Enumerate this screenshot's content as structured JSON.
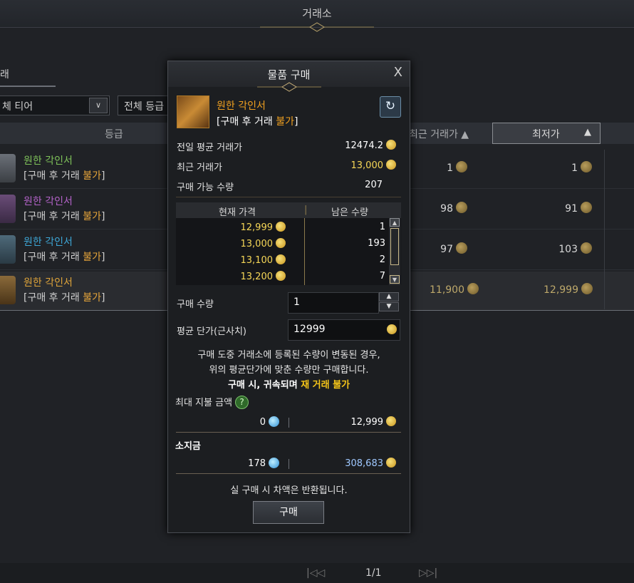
{
  "window": {
    "title": "거래소"
  },
  "background": {
    "tab_label": "래",
    "tier_dropdown": "체 티어",
    "grade_dropdown": "전체 등급",
    "header": {
      "grade": "등급",
      "recent": "최근 거래가",
      "lowest": "최저가"
    },
    "rows": [
      {
        "name": "원한 각인서",
        "note_prefix": "[구매 후 거래 ",
        "note_flag": "불가",
        "note_suffix": "]",
        "recent": "1",
        "lowest": "1",
        "name_color": "#7fc35a"
      },
      {
        "name": "원한 각인서",
        "note_prefix": "[구매 후 거래 ",
        "note_flag": "불가",
        "note_suffix": "]",
        "recent": "98",
        "lowest": "91",
        "name_color": "#b463c9"
      },
      {
        "name": "원한 각인서",
        "note_prefix": "[구매 후 거래 ",
        "note_flag": "불가",
        "note_suffix": "]",
        "recent": "97",
        "lowest": "103",
        "name_color": "#3ea8d8"
      },
      {
        "name": "원한 각인서",
        "note_prefix": "[구매 후 거래 ",
        "note_flag": "불가",
        "note_suffix": "]",
        "recent": "11,900",
        "lowest": "12,999",
        "name_color": "#e0a53a"
      }
    ],
    "pager": {
      "page": "1/1"
    }
  },
  "modal": {
    "title": "물품 구매",
    "close": "X",
    "item_name": "원한 각인서",
    "item_note_prefix": "[구매 후 거래 ",
    "item_note_flag": "불가",
    "item_note_suffix": "]",
    "stats": [
      {
        "label": "전일 평균 거래가",
        "value": "12474.2"
      },
      {
        "label": "최근 거래가",
        "value": "13,000"
      },
      {
        "label": "구매 가능 수량",
        "value": "207"
      }
    ],
    "table": {
      "col_price": "현재 가격",
      "col_qty": "남은 수량",
      "rows": [
        {
          "price": "12,999",
          "qty": "1"
        },
        {
          "price": "13,000",
          "qty": "193"
        },
        {
          "price": "13,100",
          "qty": "2"
        },
        {
          "price": "13,200",
          "qty": "7"
        }
      ]
    },
    "qty_label": "구매 수량",
    "qty_value": "1",
    "avg_label": "평균 단가(근사치)",
    "avg_value": "12999",
    "notice_line1": "구매 도중 거래소에 등록된 수량이 변동된 경우,",
    "notice_line2": "위의 평균단가에 맞춘 수량만 구매합니다.",
    "notice_line3_a": "구매 시, 귀속되며 ",
    "notice_line3_b": "재 거래 불가",
    "max_pay_label": "최대 지불 금액",
    "max_pay_crystal": "0",
    "max_pay_gold": "12,999",
    "owned_label": "소지금",
    "owned_crystal": "178",
    "owned_gold": "308,683",
    "refund_note": "실 구매 시 차액은 반환됩니다.",
    "buy_button": "구매"
  }
}
